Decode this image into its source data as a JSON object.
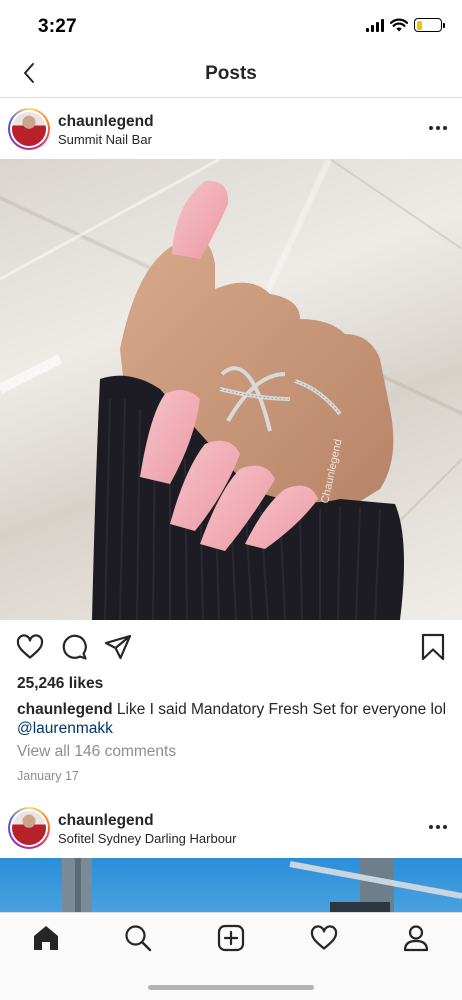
{
  "status_bar": {
    "time": "3:27"
  },
  "header": {
    "title": "Posts"
  },
  "posts": [
    {
      "username": "chaunlegend",
      "location": "Summit Nail Bar",
      "likes": "25,246 likes",
      "caption_user": "chaunlegend",
      "caption_text": "Like I said Mandatory Fresh Set for everyone lol",
      "caption_mention": "@laurenmakk",
      "view_comments": "View all 146 comments",
      "date": "January 17",
      "watermark": "Chaunlegend"
    },
    {
      "username": "chaunlegend",
      "location": "Sofitel Sydney Darling Harbour"
    }
  ],
  "icons": {
    "back": "chevron-left-icon",
    "more": "more-horizontal-icon",
    "like": "heart-icon",
    "comment": "comment-icon",
    "share": "paper-plane-icon",
    "save": "bookmark-icon"
  },
  "tab_bar": {
    "items": [
      {
        "name": "home",
        "icon": "home-icon"
      },
      {
        "name": "search",
        "icon": "search-icon"
      },
      {
        "name": "new-post",
        "icon": "add-post-icon"
      },
      {
        "name": "activity",
        "icon": "heart-icon"
      },
      {
        "name": "profile",
        "icon": "profile-icon"
      }
    ]
  },
  "colors": {
    "text": "#262626",
    "secondary_text": "#8e8e8e",
    "mention": "#00376b",
    "divider": "#dbdbdb",
    "battery": "#f5c400"
  }
}
